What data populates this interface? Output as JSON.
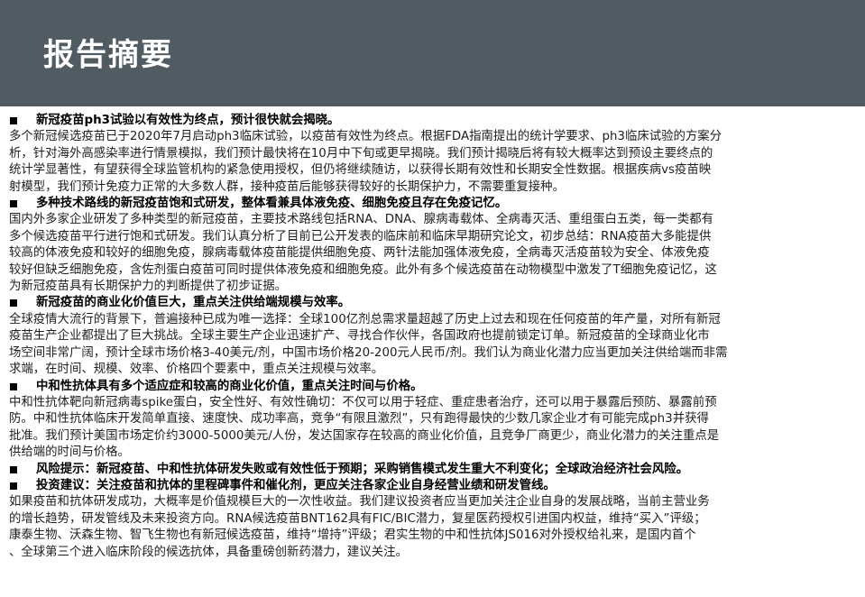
{
  "header": {
    "title": "报告摘要"
  },
  "sections": [
    {
      "heading": "新冠疫苗ph3试验以有效性为终点，预计很快就会揭晓。",
      "lines": [
        "多个新冠候选疫苗已于2020年7月启动ph3临床试验，以疫苗有效性为终点。根据FDA指南提出的统计学要求、ph3临床试验的方案分",
        "析，针对海外高感染率进行情景模拟，我们预计最快将在10月中下旬或更早揭晓。我们预计揭晓后将有较大概率达到预设主要终点的",
        "统计学显著性，有望获得全球监管机构的紧急使用授权，但仍将继续随访，以获得长期有效性和长期安全性数据。根据疾病vs疫苗映",
        "射模型，我们预计免疫力正常的大多数人群，接种疫苗后能够获得较好的长期保护力，不需要重复接种。"
      ]
    },
    {
      "heading": "多种技术路线的新冠疫苗饱和式研发，整体看兼具体液免疫、细胞免疫且存在免疫记忆。",
      "lines": [
        "国内外多家企业研发了多种类型的新冠疫苗，主要技术路线包括RNA、DNA、腺病毒载体、全病毒灭活、重组蛋白五类，每一类都有",
        "多个候选疫苗平行进行饱和式研发。我们认真分析了目前已公开发表的临床前和临床早期研究论文，初步总结：RNA疫苗大多能提供",
        "较高的体液免疫和较好的细胞免疫，腺病毒载体疫苗能提供细胞免疫、两针法能加强体液免疫，全病毒灭活疫苗较为安全、体液免疫",
        "较好但缺乏细胞免疫，含佐剂蛋白疫苗可同时提供体液免疫和细胞免疫。此外有多个候选疫苗在动物模型中激发了T细胞免疫记忆，这",
        "为新冠疫苗具有长期保护力的判断提供了初步证据。"
      ]
    },
    {
      "heading": "新冠疫苗的商业化价值巨大，重点关注供给端规模与效率。",
      "lines": [
        "全球疫情大流行的背景下，普遍接种已成为唯一选择：全球100亿剂总需求量超越了历史上过去和现在任何疫苗的年产量，对所有新冠",
        "疫苗生产企业都提出了巨大挑战。全球主要生产企业迅速扩产、寻找合作伙伴，各国政府也提前锁定订单。新冠疫苗的全球商业化市",
        "场空间非常广阔，预计全球市场价格3-40美元/剂，中国市场价格20-200元人民币/剂。我们认为商业化潜力应当更加关注供给端而非需",
        "求端，在时间、规模、效率、价格四个要素中，重点关注规模与效率。"
      ]
    },
    {
      "heading": "中和性抗体具有多个适应症和较高的商业化价值，重点关注时间与价格。",
      "lines": [
        "中和性抗体靶向新冠病毒spike蛋白，安全性好、有效性确切：不仅可以用于轻症、重症患者治疗，还可以用于暴露后预防、暴露前预",
        "防。中和性抗体临床开发简单直接、速度快、成功率高，竞争“有限且激烈”，只有跑得最快的少数几家企业才有可能完成ph3并获得",
        "批准。我们预计美国市场定价约3000-5000美元/人份，发达国家存在较高的商业化价值，且竞争厂商更少，商业化潜力的关注重点是",
        "供给端的时间与价格。"
      ]
    },
    {
      "heading": "风险提示：新冠疫苗、中和性抗体研发失败或有效性低于预期；采购销售模式发生重大不利变化；全球政治经济社会风险。",
      "lines": []
    },
    {
      "heading": "投资建议：关注疫苗和抗体的里程碑事件和催化剂，更应关注各家企业自身经营业绩和研发管线。",
      "lines": [
        "如果疫苗和抗体研发成功，大概率是价值规模巨大的一次性收益。我们建议投资者应当更加关注企业自身的发展战略，当前主营业务",
        "的增长趋势，研发管线及未来投资方向。RNA候选疫苗BNT162具有FIC/BIC潜力，复星医药授权引进国内权益，维持“买入”评级；",
        "康泰生物、沃森生物、智飞生物也有新冠候选疫苗，维持“增持”评级；君实生物的中和性抗体JS016对外授权给礼来，是国内首个",
        "、全球第三个进入临床阶段的候选抗体，具备重磅创新药潜力，建议关注。"
      ]
    }
  ]
}
